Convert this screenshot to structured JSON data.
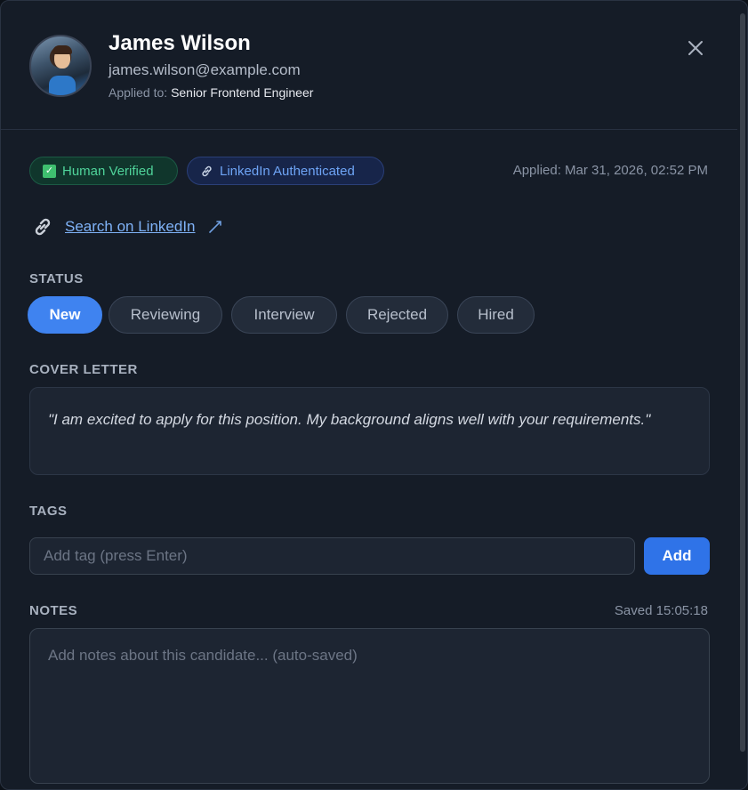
{
  "candidate": {
    "name": "James Wilson",
    "email": "james.wilson@example.com",
    "applied_to_label": "Applied to:",
    "job_title": "Senior Frontend Engineer"
  },
  "badges": {
    "verified": "Human Verified",
    "linkedin": "LinkedIn Authenticated"
  },
  "applied_date": "Applied: Mar 31, 2026, 02:52 PM",
  "linkedin_search": "Search on LinkedIn",
  "status": {
    "label": "STATUS",
    "options": [
      "New",
      "Reviewing",
      "Interview",
      "Rejected",
      "Hired"
    ],
    "selected": "New"
  },
  "cover_letter": {
    "label": "COVER LETTER",
    "text": "\"I am excited to apply for this position. My background aligns well with your requirements.\""
  },
  "tags": {
    "label": "TAGS",
    "placeholder": "Add tag (press Enter)",
    "add_label": "Add"
  },
  "notes": {
    "label": "NOTES",
    "saved": "Saved 15:05:18",
    "placeholder": "Add notes about this candidate... (auto-saved)"
  },
  "colors": {
    "accent": "#3f83f0",
    "verified_green": "#4fd39a",
    "linkedin_blue": "#6ea4f5",
    "background": "#151c27"
  },
  "icons": {
    "close": "close-icon",
    "verified": "check-icon",
    "linkedin": "link-icon",
    "external": "external-link-icon"
  }
}
